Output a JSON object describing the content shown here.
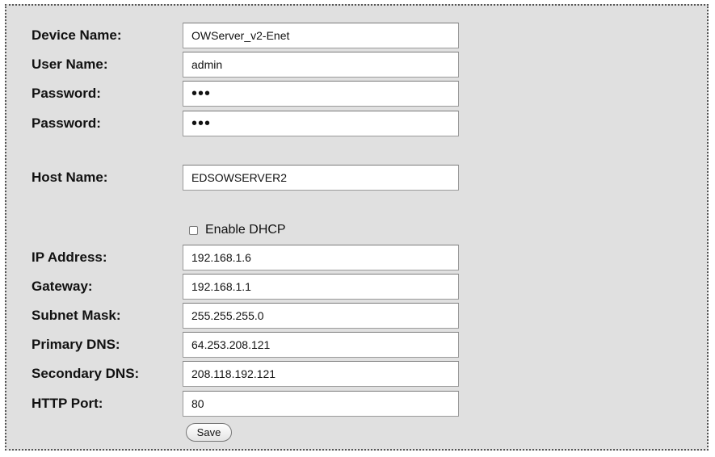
{
  "form": {
    "device_name": {
      "label": "Device Name:",
      "value": "OWServer_v2-Enet"
    },
    "user_name": {
      "label": "User Name:",
      "value": "admin"
    },
    "password": {
      "label": "Password:",
      "value": "•••"
    },
    "password_confirm": {
      "label": "Password:",
      "value": "•••"
    },
    "host_name": {
      "label": "Host Name:",
      "value": "EDSOWSERVER2"
    },
    "dhcp": {
      "label": "Enable DHCP",
      "checked": false
    },
    "ip_address": {
      "label": "IP Address:",
      "value": "192.168.1.6"
    },
    "gateway": {
      "label": "Gateway:",
      "value": "192.168.1.1"
    },
    "subnet_mask": {
      "label": "Subnet Mask:",
      "value": "255.255.255.0"
    },
    "primary_dns": {
      "label": "Primary DNS:",
      "value": "64.253.208.121"
    },
    "secondary_dns": {
      "label": "Secondary DNS:",
      "value": "208.118.192.121"
    },
    "http_port": {
      "label": "HTTP Port:",
      "value": "80"
    },
    "save_label": "Save"
  }
}
